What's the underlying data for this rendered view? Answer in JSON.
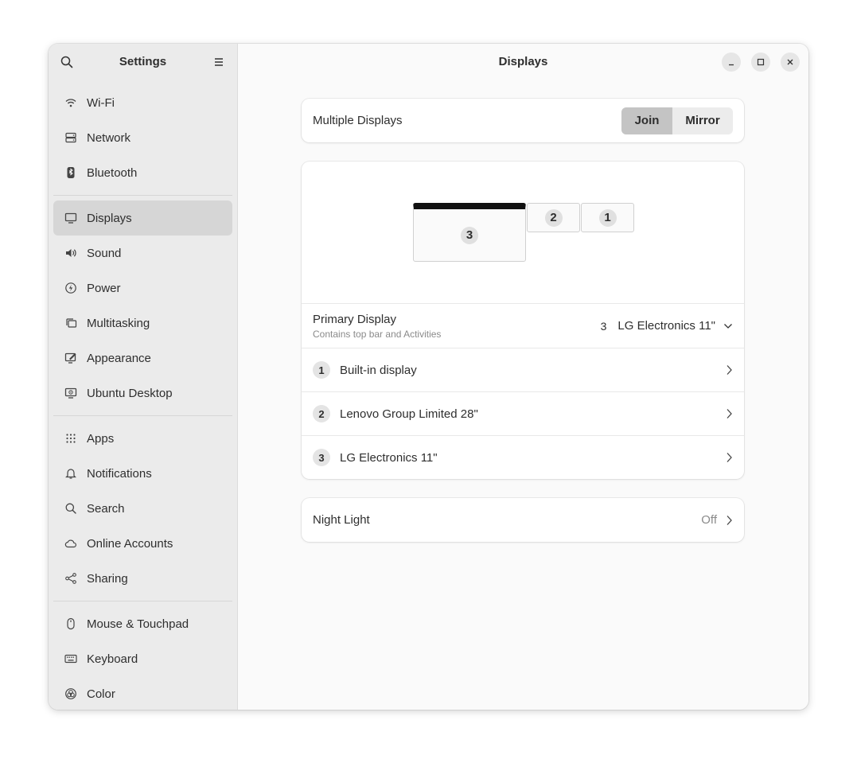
{
  "sidebar": {
    "title": "Settings",
    "groups": [
      [
        {
          "label": "Wi-Fi",
          "icon": "wifi-icon"
        },
        {
          "label": "Network",
          "icon": "network-icon"
        },
        {
          "label": "Bluetooth",
          "icon": "bluetooth-icon"
        }
      ],
      [
        {
          "label": "Displays",
          "icon": "display-icon",
          "active": true
        },
        {
          "label": "Sound",
          "icon": "speaker-icon"
        },
        {
          "label": "Power",
          "icon": "power-icon"
        },
        {
          "label": "Multitasking",
          "icon": "multitasking-icon"
        },
        {
          "label": "Appearance",
          "icon": "appearance-icon"
        },
        {
          "label": "Ubuntu Desktop",
          "icon": "ubuntu-desktop-icon"
        }
      ],
      [
        {
          "label": "Apps",
          "icon": "apps-grid-icon"
        },
        {
          "label": "Notifications",
          "icon": "bell-icon"
        },
        {
          "label": "Search",
          "icon": "search-icon"
        },
        {
          "label": "Online Accounts",
          "icon": "cloud-icon"
        },
        {
          "label": "Sharing",
          "icon": "share-icon"
        }
      ],
      [
        {
          "label": "Mouse & Touchpad",
          "icon": "mouse-icon"
        },
        {
          "label": "Keyboard",
          "icon": "keyboard-icon"
        },
        {
          "label": "Color",
          "icon": "color-icon"
        }
      ]
    ]
  },
  "main": {
    "title": "Displays",
    "multiple_displays": {
      "label": "Multiple Displays",
      "options": [
        "Join",
        "Mirror"
      ],
      "selected": "Join"
    },
    "arrangement": {
      "monitors": [
        "3",
        "2",
        "1"
      ],
      "primary": "3"
    },
    "primary_display": {
      "label": "Primary Display",
      "sublabel": "Contains top bar and Activities",
      "number": "3",
      "value": "LG Electronics 11\""
    },
    "displays": [
      {
        "number": "1",
        "name": "Built-in display"
      },
      {
        "number": "2",
        "name": "Lenovo Group Limited 28\""
      },
      {
        "number": "3",
        "name": "LG Electronics 11\""
      }
    ],
    "night_light": {
      "label": "Night Light",
      "value": "Off"
    }
  },
  "colors": {
    "sidebar_bg": "#ebebeb",
    "active_item": "#d6d6d6",
    "card_bg": "#ffffff"
  }
}
